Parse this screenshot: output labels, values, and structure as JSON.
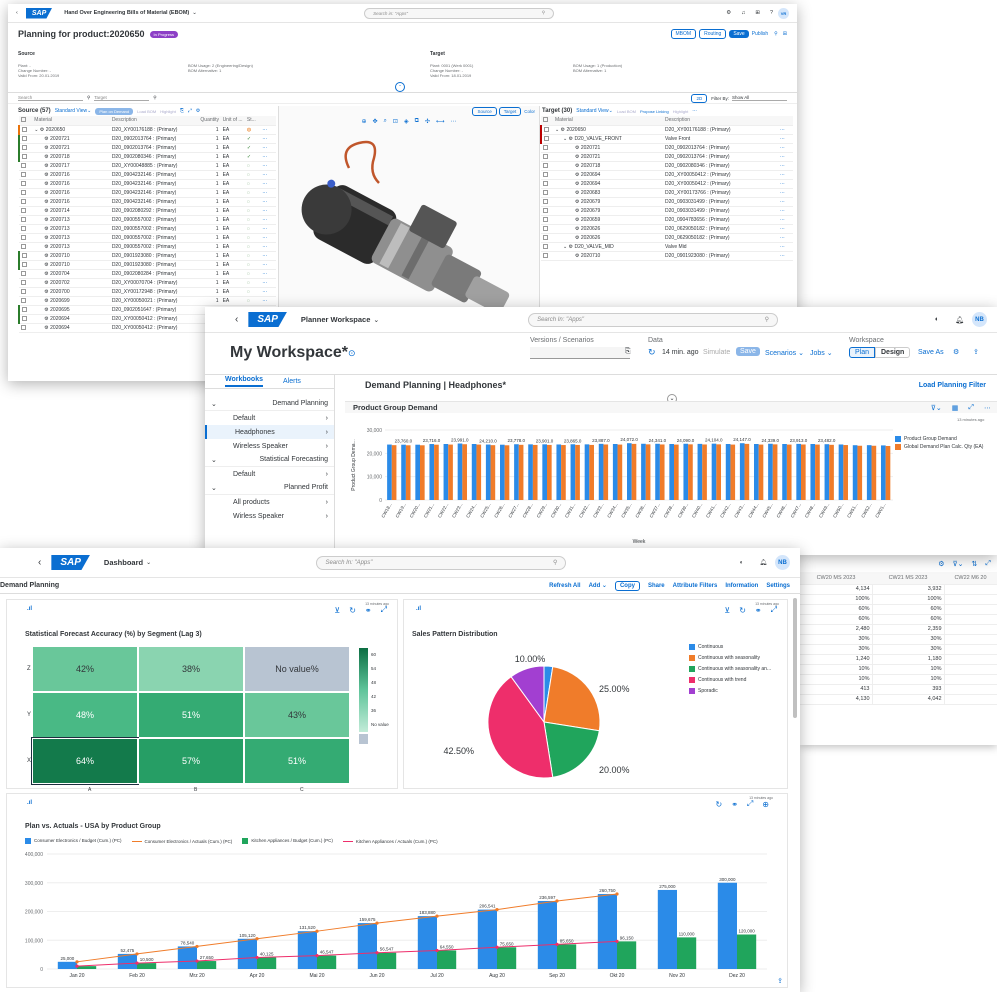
{
  "w1": {
    "app_title": "Hand Over Engineering Bills of Material (EBOM)",
    "search_placeholder": "Search in: \"Apps\"",
    "user": "VR",
    "page_title": "Planning for product:2020650",
    "status": "In Progress",
    "actions": [
      "MBOM",
      "Routing",
      "Save",
      "Publish"
    ],
    "source_label": "Source",
    "target_label": "Target",
    "source_info": [
      "Plant: -",
      "Change Number: -",
      "Valid From: 20.01.2019"
    ],
    "source_info2": [
      "BOM Usage: 2 (Engineering/Design)",
      "BOM Alternative: 1"
    ],
    "target_info": [
      "Plant: 0001 (Werk 0001)",
      "Change Number: -",
      "Valid From: 18.01.2019"
    ],
    "target_info2": [
      "BOM Usage: 1 (Production)",
      "BOM Alternative: 1"
    ],
    "filter_search": "Search",
    "filter_target": "Target",
    "filter_by": "Filter By:",
    "filter_value": "Show All",
    "source_panel": "Source (57)",
    "target_panel": "Target (30)",
    "view": "Standard View",
    "plan_on_demand": "Plan on Demand",
    "load_bom": "Load BOM",
    "highlight": "Highlight",
    "propose_linking": "Propose Linking",
    "toggle_source": "Source",
    "toggle_target": "Target",
    "toggle_color": "Color",
    "source_cols": [
      "Material",
      "Description",
      "Quantity",
      "Unit of ...",
      "St..."
    ],
    "target_cols": [
      "Material",
      "Description"
    ],
    "source_rows": [
      {
        "m": "2020650",
        "d": "D20_XY00176188 : (Primary)",
        "q": "1",
        "u": "EA"
      },
      {
        "m": "2020721",
        "d": "D20_0902013764 : (Primary)",
        "q": "1",
        "u": "EA"
      },
      {
        "m": "2020721",
        "d": "D20_0902013764 : (Primary)",
        "q": "1",
        "u": "EA"
      },
      {
        "m": "2020718",
        "d": "D20_0902080346 : (Primary)",
        "q": "1",
        "u": "EA"
      },
      {
        "m": "2020717",
        "d": "D20_XY00048885 : (Primary)",
        "q": "1",
        "u": "EA"
      },
      {
        "m": "2020716",
        "d": "D20_0904232146 : (Primary)",
        "q": "1",
        "u": "EA"
      },
      {
        "m": "2020716",
        "d": "D20_0904232146 : (Primary)",
        "q": "1",
        "u": "EA"
      },
      {
        "m": "2020716",
        "d": "D20_0904232146 : (Primary)",
        "q": "1",
        "u": "EA"
      },
      {
        "m": "2020716",
        "d": "D20_0904232146 : (Primary)",
        "q": "1",
        "u": "EA"
      },
      {
        "m": "2020714",
        "d": "D20_0902080292 : (Primary)",
        "q": "1",
        "u": "EA"
      },
      {
        "m": "2020713",
        "d": "D20_0900557002 : (Primary)",
        "q": "1",
        "u": "EA"
      },
      {
        "m": "2020713",
        "d": "D20_0900557002 : (Primary)",
        "q": "1",
        "u": "EA"
      },
      {
        "m": "2020713",
        "d": "D20_0900557002 : (Primary)",
        "q": "1",
        "u": "EA"
      },
      {
        "m": "2020713",
        "d": "D20_0900557002 : (Primary)",
        "q": "1",
        "u": "EA"
      },
      {
        "m": "2020710",
        "d": "D20_0901923080 : (Primary)",
        "q": "1",
        "u": "EA"
      },
      {
        "m": "2020710",
        "d": "D20_0901923080 : (Primary)",
        "q": "1",
        "u": "EA"
      },
      {
        "m": "2020704",
        "d": "D20_0902080284 : (Primary)",
        "q": "1",
        "u": "EA"
      },
      {
        "m": "2020702",
        "d": "D20_XY00070704 : (Primary)",
        "q": "1",
        "u": "EA"
      },
      {
        "m": "2020700",
        "d": "D20_XY00172948 : (Primary)",
        "q": "1",
        "u": "EA"
      },
      {
        "m": "2020699",
        "d": "D20_XY00050021 : (Primary)",
        "q": "1",
        "u": "EA"
      },
      {
        "m": "2020695",
        "d": "D20_0902051647 : (Primary)",
        "q": "1",
        "u": "EA"
      },
      {
        "m": "2020694",
        "d": "D20_XY00050412 : (Primary)",
        "q": "1",
        "u": "EA"
      },
      {
        "m": "2020694",
        "d": "D20_XY00050412 : (Primary)",
        "q": "1",
        "u": "EA"
      }
    ],
    "target_rows": [
      {
        "m": "2020650",
        "d": "D20_XY00176188 : (Primary)"
      },
      {
        "m": "D20_VALVE_FRONT",
        "d": "Valve Front"
      },
      {
        "m": "2020721",
        "d": "D20_0902013764 : (Primary)"
      },
      {
        "m": "2020721",
        "d": "D20_0902013764 : (Primary)"
      },
      {
        "m": "2020718",
        "d": "D20_0902080346 : (Primary)"
      },
      {
        "m": "2020694",
        "d": "D20_XY00050412 : (Primary)"
      },
      {
        "m": "2020694",
        "d": "D20_XY00050412 : (Primary)"
      },
      {
        "m": "2020683",
        "d": "D20_XY00173766 : (Primary)"
      },
      {
        "m": "2020679",
        "d": "D20_0903031499 : (Primary)"
      },
      {
        "m": "2020679",
        "d": "D20_0903031499 : (Primary)"
      },
      {
        "m": "2020659",
        "d": "D20_0904783656 : (Primary)"
      },
      {
        "m": "2020626",
        "d": "D20_0629050182 : (Primary)"
      },
      {
        "m": "2020626",
        "d": "D20_0629050182 : (Primary)"
      },
      {
        "m": "D20_VALVE_MID",
        "d": "Valve Mid"
      },
      {
        "m": "2020710",
        "d": "D20_0901923080 : (Primary)"
      }
    ]
  },
  "w2": {
    "app_title": "Planner Workspace",
    "search_placeholder": "Search In: \"Apps\"",
    "user": "NB",
    "title": "My Workspace*",
    "versions_label": "Versions / Scenarios",
    "data_label": "Data",
    "data_age": "14 min. ago",
    "simulate": "Simulate",
    "save": "Save",
    "scenarios": "Scenarios",
    "jobs": "Jobs",
    "workspace_label": "Workspace",
    "plan": "Plan",
    "design": "Design",
    "save_as": "Save As",
    "tabs": [
      "Workbooks",
      "Alerts"
    ],
    "nav": [
      {
        "label": "Demand Planning",
        "group": true
      },
      {
        "label": "Default"
      },
      {
        "label": "Headphones",
        "selected": true
      },
      {
        "label": "Wireless Speaker"
      },
      {
        "label": "Statistical Forecasting",
        "group": true
      },
      {
        "label": "Default"
      },
      {
        "label": "Planned Profit",
        "group": true
      },
      {
        "label": "All products"
      },
      {
        "label": "Wirless Speaker"
      }
    ],
    "workbook_title": "Demand Planning | Headphones*",
    "load_filter": "Load Planning Filter",
    "chart_title": "Product Group Demand",
    "chart_age": "13 minutes ago",
    "chart_data": {
      "type": "bar",
      "title": "Product Group Demand",
      "xlabel": "Week",
      "ylabel": "Product Group Dema...",
      "ylim": [
        0,
        30000
      ],
      "yticks": [
        "30,000",
        "20,000",
        "10,000",
        "0"
      ],
      "categories": [
        "CW18...",
        "CW19...",
        "CW20...",
        "CW21...",
        "CW22...",
        "CW23...",
        "CW24...",
        "CW25...",
        "CW26...",
        "CW27...",
        "CW28...",
        "CW29...",
        "CW30...",
        "CW31...",
        "CW32...",
        "CW33...",
        "CW34...",
        "CW35...",
        "CW36...",
        "CW37...",
        "CW38...",
        "CW39...",
        "CW40...",
        "CW41...",
        "CW42...",
        "CW43...",
        "CW44...",
        "CW45...",
        "CW46...",
        "CW47...",
        "CW48...",
        "CW49...",
        "CW50...",
        "CW51...",
        "CW52...",
        "CW01..."
      ],
      "series": [
        {
          "name": "Product Group Demand",
          "color": "#2b8be8",
          "values": [
            23760,
            23700,
            23700,
            23990,
            24000,
            24210,
            24000,
            23770,
            23700,
            23900,
            23850,
            23865,
            23800,
            23887,
            23850,
            24072,
            24000,
            24341,
            24100,
            24090,
            24000,
            24104,
            24050,
            24147,
            24000,
            24339,
            24000,
            24100,
            24000,
            24050,
            24000,
            23913,
            23800,
            23482,
            23500,
            23400
          ]
        },
        {
          "name": "Global Demand Plan Calc. Qty (EA)",
          "color": "#f07c2a",
          "values": [
            23500,
            23450,
            23450,
            23700,
            23750,
            23900,
            23750,
            23500,
            23450,
            23650,
            23600,
            23600,
            23550,
            23600,
            23600,
            23800,
            23750,
            24050,
            23850,
            23800,
            23750,
            23850,
            23800,
            23850,
            23750,
            24050,
            23750,
            23850,
            23750,
            23800,
            23750,
            23650,
            23550,
            23250,
            23250,
            23150
          ]
        }
      ],
      "data_labels": [
        "23,760.0",
        "23,716.0",
        "23,991.0",
        "24,210.0",
        "23,778.0",
        "23,901.0",
        "23,865.0",
        "23,887.0",
        "24,072.0",
        "24,341.0",
        "24,090.0",
        "24,104.0",
        "24,147.0",
        "24,339.0",
        "23,913.0",
        "23,482.0"
      ]
    }
  },
  "w3": {
    "app_title": "Dashboard",
    "search_placeholder": "Search In: \"Apps\"",
    "user": "NB",
    "page_title": "Demand Planning",
    "actions": [
      "Refresh All",
      "Add",
      "Copy",
      "Share",
      "Attribute Filters",
      "Information",
      "Settings"
    ],
    "card_age": "13 minutes ago",
    "heatmap": {
      "type": "heatmap",
      "title": "Statistical Forecast Accuracy (%) by Segment (Lag 3)",
      "rows": [
        "Z",
        "Y",
        "X"
      ],
      "cols": [
        "A",
        "B",
        "C"
      ],
      "values": [
        [
          "42%",
          "38%",
          "No value%"
        ],
        [
          "48%",
          "51%",
          "43%"
        ],
        [
          "64%",
          "57%",
          "51%"
        ]
      ],
      "legend": [
        "60",
        "54",
        "48",
        "42",
        "36",
        "No value"
      ]
    },
    "pie": {
      "type": "pie",
      "title": "Sales Pattern Distribution",
      "slices": [
        {
          "name": "Continuous",
          "value": 2.5,
          "color": "#2b8be8"
        },
        {
          "name": "Continuous with seasonality",
          "value": 25,
          "color": "#f07c2a"
        },
        {
          "name": "Continuous with seasonality an...",
          "value": 20,
          "color": "#20a55c"
        },
        {
          "name": "Continuous with trend",
          "value": 42.5,
          "color": "#ee2e6b"
        },
        {
          "name": "Sporadic",
          "value": 10,
          "color": "#a23fd1"
        }
      ],
      "labels": [
        "10.00%",
        "25.00%",
        "20.00%",
        "42.50%"
      ]
    },
    "combo": {
      "type": "bar",
      "title": "Plan vs. Actuals - USA by Product Group",
      "categories": [
        "Jan 20",
        "Feb 20",
        "Mrz 20",
        "Apr 20",
        "Mai 20",
        "Jun 20",
        "Jul 20",
        "Aug 20",
        "Sep 20",
        "Okt 20",
        "Nov 20",
        "Dez 20"
      ],
      "ylim": [
        0,
        400000
      ],
      "yticks": [
        "400,000",
        "300,000",
        "200,000",
        "100,000",
        "0"
      ],
      "series": [
        {
          "name": "Consumer Electronics / Budget (Cum.) (PC)",
          "kind": "bar",
          "color": "#2b8be8",
          "values": [
            25000,
            52475,
            78540,
            105120,
            131520,
            159675,
            183880,
            206541,
            236597,
            260750,
            275000,
            300000
          ]
        },
        {
          "name": "Consumer Electronics / Actuals (Cum.) (PC)",
          "kind": "line",
          "color": "#f07c2a",
          "values": [
            25000,
            52475,
            78540,
            105120,
            131520,
            159675,
            183880,
            206541,
            236597,
            260750
          ]
        },
        {
          "name": "Kitchen Appliances / Budget (Cum.) (PC)",
          "kind": "bar",
          "color": "#20a55c",
          "values": [
            10000,
            20500,
            27650,
            40125,
            46547,
            56547,
            64550,
            75650,
            85650,
            96150,
            110000,
            120000
          ]
        },
        {
          "name": "Kitchen Appliances / Actuals (Cum.) (PC)",
          "kind": "line",
          "color": "#ee2e6b",
          "values": [
            10000,
            20500,
            27650,
            40125,
            46547,
            56547,
            64550,
            75650,
            85650,
            96150
          ]
        }
      ],
      "bar1_labels": [
        "25,000",
        "52,475",
        "78,540",
        "105,120",
        "131,520",
        "159,675",
        "183,880",
        "206,541",
        "236,597",
        "260,750",
        "275,000",
        "300,000"
      ],
      "bar2_labels": [
        "",
        "10,500",
        "27,650",
        "40,125",
        "46,547",
        "56,547",
        "64,550",
        "75,650",
        "85,650",
        "96,150",
        "110,000",
        "120,000"
      ]
    }
  },
  "w4": {
    "headers": [
      "CW20 MS 2023",
      "CW21 MS 2023",
      "CW22 M6 20"
    ],
    "rows": [
      [
        "4,134",
        "3,932"
      ],
      [
        "100%",
        "100%"
      ],
      [
        "60%",
        "60%"
      ],
      [
        "60%",
        "60%"
      ],
      [
        "2,480",
        "2,359"
      ],
      [
        "30%",
        "30%"
      ],
      [
        "30%",
        "30%"
      ],
      [
        "1,240",
        "1,180"
      ],
      [
        "10%",
        "10%"
      ],
      [
        "10%",
        "10%"
      ],
      [
        "413",
        "393"
      ],
      [
        "4,130",
        "4,042"
      ]
    ]
  }
}
